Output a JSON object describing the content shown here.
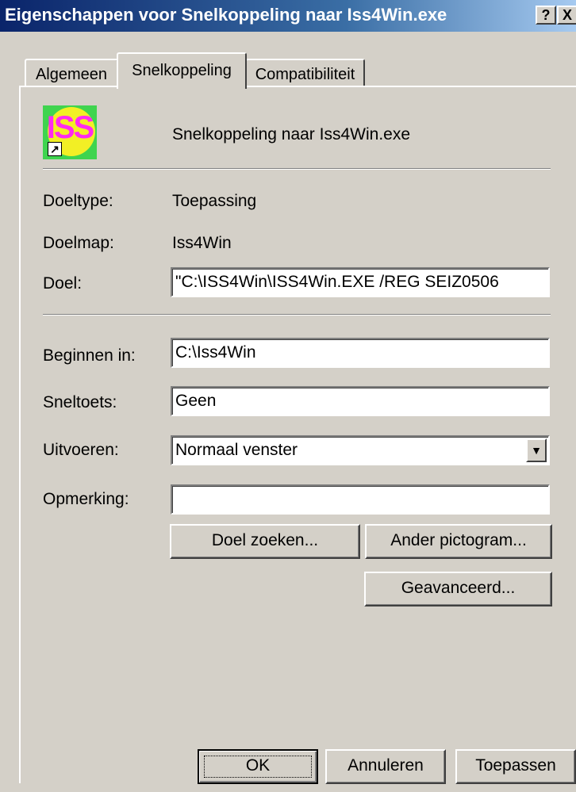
{
  "window": {
    "title": "Eigenschappen voor Snelkoppeling naar Iss4Win.exe",
    "help_label": "?",
    "close_label": "X"
  },
  "tabs": [
    {
      "label": "Algemeen"
    },
    {
      "label": "Snelkoppeling",
      "selected": true
    },
    {
      "label": "Compatibiliteit"
    }
  ],
  "shortcut": {
    "icon_text": "ISS",
    "name": "Snelkoppeling naar Iss4Win.exe"
  },
  "fields": {
    "doeltype": {
      "label": "Doeltype:",
      "value": "Toepassing"
    },
    "doelmap": {
      "label": "Doelmap:",
      "value": "Iss4Win"
    },
    "doel": {
      "label": "Doel:",
      "value": "\"C:\\ISS4Win\\ISS4Win.EXE  /REG SEIZ0506"
    },
    "beginnen_in": {
      "label": "Beginnen in:",
      "value": "C:\\Iss4Win"
    },
    "sneltoets": {
      "label": "Sneltoets:",
      "value": "Geen"
    },
    "uitvoeren": {
      "label": "Uitvoeren:",
      "value": "Normaal venster"
    },
    "opmerking": {
      "label": "Opmerking:",
      "value": ""
    }
  },
  "buttons": {
    "doel_zoeken": "Doel zoeken...",
    "ander_pictogram": "Ander pictogram...",
    "geavanceerd": "Geavanceerd...",
    "ok": "OK",
    "annuleren": "Annuleren",
    "toepassen": "Toepassen"
  },
  "colors": {
    "titlebar_start": "#0a246a",
    "titlebar_end": "#a6caf0",
    "dialog_face": "#d4d0c8"
  }
}
